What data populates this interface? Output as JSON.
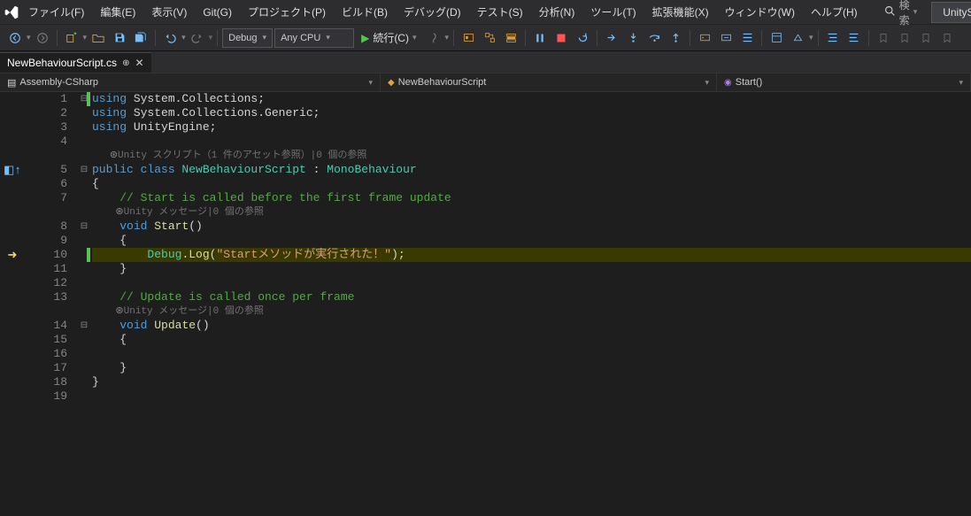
{
  "menu": {
    "items": [
      "ファイル(F)",
      "編集(E)",
      "表示(V)",
      "Git(G)",
      "プロジェクト(P)",
      "ビルド(B)",
      "デバッグ(D)",
      "テスト(S)",
      "分析(N)",
      "ツール(T)",
      "拡張機能(X)",
      "ウィンドウ(W)",
      "ヘルプ(H)"
    ],
    "search": "検索",
    "solution": "UnitySample"
  },
  "toolbar": {
    "config": "Debug",
    "platform": "Any CPU",
    "run": "続行(C)"
  },
  "tab": {
    "filename": "NewBehaviourScript.cs"
  },
  "nav": {
    "assembly": "Assembly-CSharp",
    "class": "NewBehaviourScript",
    "member": "Start()"
  },
  "code": {
    "lens1": "Unity スクリプト（1 件のアセット参照）|0 個の参照",
    "lens2": "Unity メッセージ|0 個の参照",
    "lens3": "Unity メッセージ|0 個の参照",
    "l1a": "using ",
    "l1b": "System.Collections;",
    "l2a": "using ",
    "l2b": "System.Collections.Generic;",
    "l3a": "using ",
    "l3b": "UnityEngine;",
    "l5a": "public class ",
    "l5b": "NewBehaviourScript",
    "l5c": " : ",
    "l5d": "MonoBehaviour",
    "l6": "{",
    "l7": "// Start is called before the first frame update",
    "l8a": "void ",
    "l8b": "Start",
    "l8c": "()",
    "l9": "{",
    "l10a": "Debug",
    "l10b": ".",
    "l10c": "Log",
    "l10d": "(",
    "l10e": "\"Startメソッドが実行された！\"",
    "l10f": ");",
    "l11": "}",
    "l13": "// Update is called once per frame",
    "l14a": "void ",
    "l14b": "Update",
    "l14c": "()",
    "l15": "{",
    "l17": "}",
    "l18": "}"
  },
  "line_numbers": [
    "1",
    "2",
    "3",
    "4",
    "5",
    "6",
    "7",
    "8",
    "9",
    "10",
    "11",
    "12",
    "13",
    "14",
    "15",
    "16",
    "17",
    "18",
    "19"
  ]
}
